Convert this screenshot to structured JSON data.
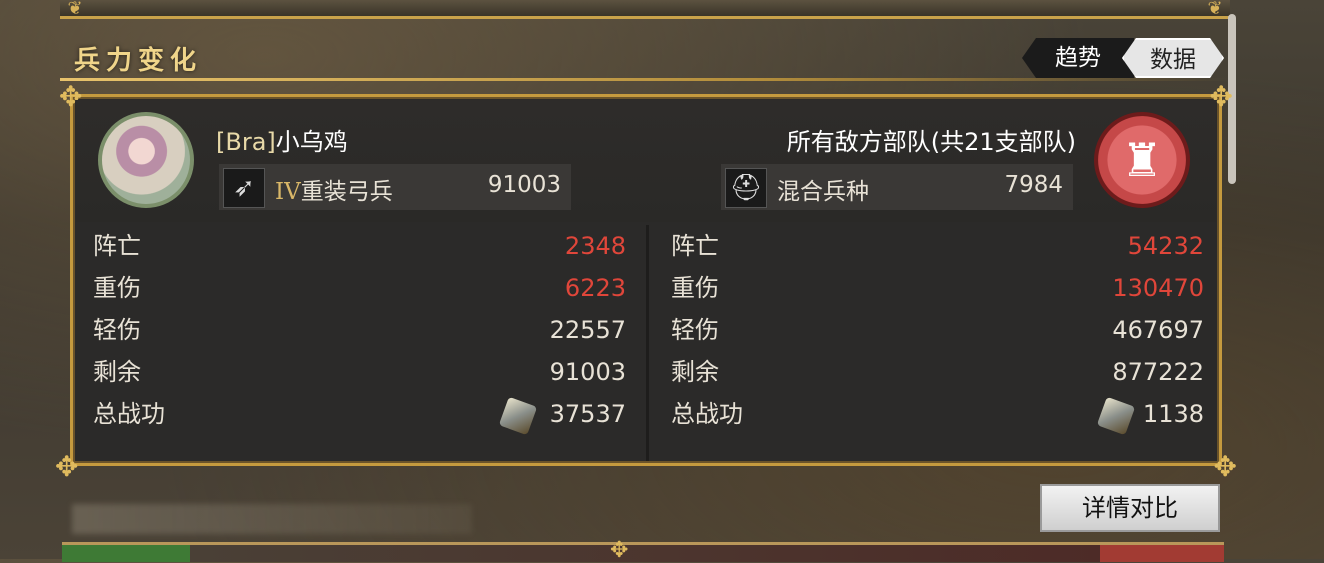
{
  "section": {
    "title": "兵力变化"
  },
  "toggle": {
    "trend_label": "趋势",
    "data_label": "数据",
    "selected": "data"
  },
  "player": {
    "tag": "[Bra]",
    "name": "小乌鸡",
    "unit_tier": "IV",
    "unit_type": "重装弓兵",
    "unit_count": "91003",
    "stats": [
      {
        "label": "阵亡",
        "value": "2348",
        "color": "red"
      },
      {
        "label": "重伤",
        "value": "6223",
        "color": "red"
      },
      {
        "label": "轻伤",
        "value": "22557",
        "color": "normal"
      },
      {
        "label": "剩余",
        "value": "91003",
        "color": "normal"
      },
      {
        "label": "总战功",
        "value": "37537",
        "color": "normal"
      }
    ]
  },
  "enemy": {
    "name": "所有敌方部队(共21支部队)",
    "unit_type": "混合兵种",
    "unit_count": "7984",
    "stats": [
      {
        "label": "阵亡",
        "value": "54232",
        "color": "red"
      },
      {
        "label": "重伤",
        "value": "130470",
        "color": "red"
      },
      {
        "label": "轻伤",
        "value": "467697",
        "color": "normal"
      },
      {
        "label": "剩余",
        "value": "877222",
        "color": "normal"
      },
      {
        "label": "总战功",
        "value": "1138",
        "color": "normal"
      }
    ]
  },
  "actions": {
    "detail_compare_label": "详情对比"
  },
  "colors": {
    "accent_gold": "#c59a3e",
    "loss_red": "#e0463a",
    "panel_bg": "#2b2a29"
  },
  "icons": {
    "bow": "bow-icon",
    "helmet": "helmet-icon",
    "merit": "merit-medal-icon"
  }
}
